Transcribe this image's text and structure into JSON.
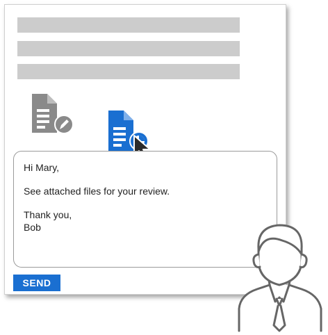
{
  "email": {
    "greeting": "Hi Mary,",
    "body": "See attached files for your review.",
    "closing": "Thank you,",
    "signature": "Bob"
  },
  "actions": {
    "send_label": "SEND"
  },
  "icons": {
    "edit_document": "document-edit-icon",
    "chart_document": "document-chart-icon",
    "cursor": "mouse-pointer-icon",
    "person": "person-outline-icon"
  },
  "colors": {
    "accent": "#1a6fd1",
    "placeholder": "#cccccc",
    "icon_gray": "#8a8a8a"
  }
}
